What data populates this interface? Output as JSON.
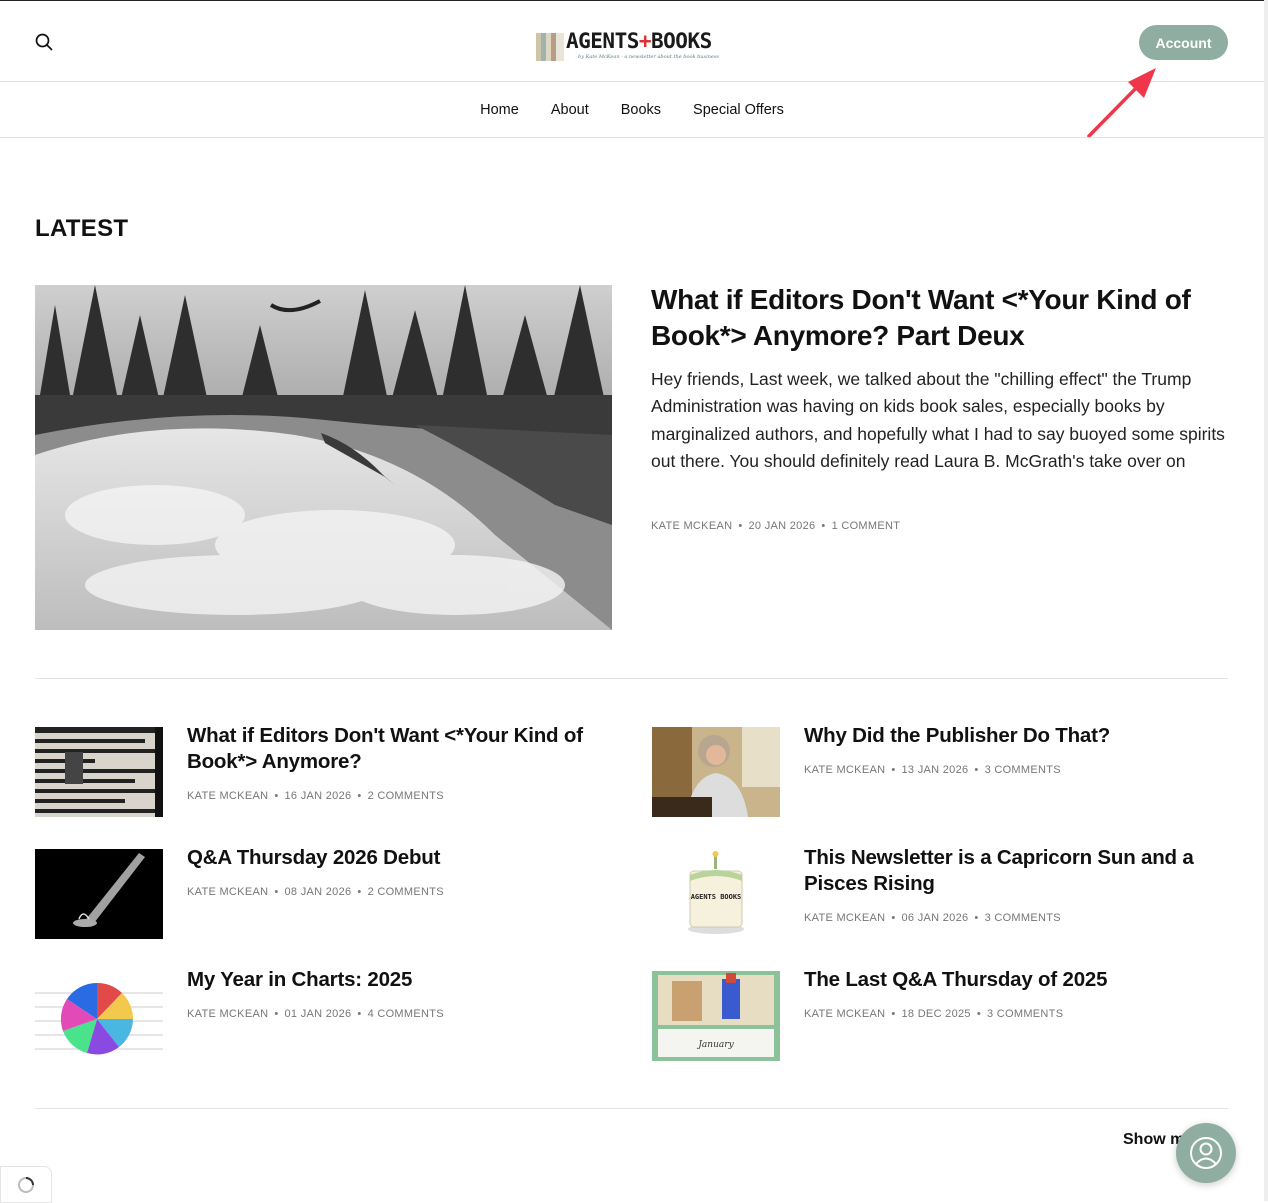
{
  "header": {
    "logo": {
      "title_left": "AGENTS",
      "plus": "+",
      "title_right": "BOOKS",
      "tagline": "by Kate McKean · a newsletter about the book business"
    },
    "account_label": "Account"
  },
  "nav": {
    "items": [
      "Home",
      "About",
      "Books",
      "Special Offers"
    ]
  },
  "section_title": "LATEST",
  "hero": {
    "title": "What if Editors Don't Want <*Your Kind of Book*> Anymore? Part Deux",
    "excerpt": "Hey friends, Last week, we talked about the \"chilling effect\" the Trump Administration was having on kids book sales, especially books by marginalized authors, and hopefully what I had to say buoyed some spirits out there. You should definitely read Laura B. McGrath's take over on",
    "author": "KATE MCKEAN",
    "date": "20 JAN 2026",
    "comments": "1 COMMENT"
  },
  "posts": [
    {
      "title": "What if Editors Don't Want <*Your Kind of Book*> Anymore?",
      "author": "KATE MCKEAN",
      "date": "16 JAN 2026",
      "comments": "2 COMMENTS"
    },
    {
      "title": "Why Did the Publisher Do That?",
      "author": "KATE MCKEAN",
      "date": "13 JAN 2026",
      "comments": "3 COMMENTS"
    },
    {
      "title": "Q&A Thursday 2026 Debut",
      "author": "KATE MCKEAN",
      "date": "08 JAN 2026",
      "comments": "2 COMMENTS"
    },
    {
      "title": "This Newsletter is a Capricorn Sun and a Pisces Rising",
      "author": "KATE MCKEAN",
      "date": "06 JAN 2026",
      "comments": "3 COMMENTS"
    },
    {
      "title": "My Year in Charts: 2025",
      "author": "KATE MCKEAN",
      "date": "01 JAN 2026",
      "comments": "4 COMMENTS"
    },
    {
      "title": "The Last Q&A Thursday of 2025",
      "author": "KATE MCKEAN",
      "date": "18 DEC 2025",
      "comments": "3 COMMENTS"
    }
  ],
  "cake_text": "AGENTS BOOKS",
  "calendar_text": "January",
  "show_more_label": "Show m",
  "colors": {
    "accent": "#8fada0",
    "arrow": "#f0364b",
    "meta": "#777777"
  }
}
